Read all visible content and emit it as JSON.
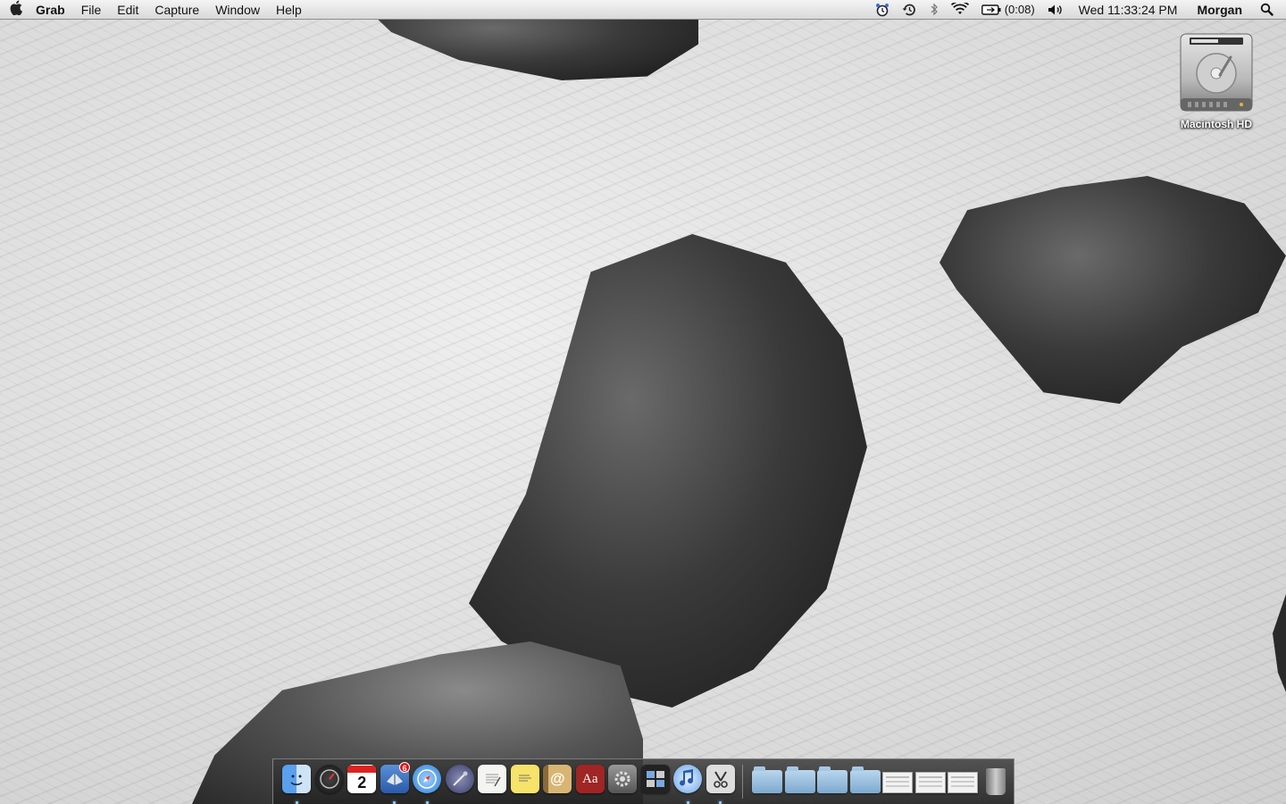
{
  "menubar": {
    "apple_icon": "apple-icon",
    "app_name": "Grab",
    "menus": [
      "File",
      "Edit",
      "Capture",
      "Window",
      "Help"
    ],
    "status": {
      "battery_time": "(0:08)",
      "clock": "Wed 11:33:24 PM",
      "user": "Morgan"
    }
  },
  "desktop": {
    "hd_label": "Macintosh HD"
  },
  "dock": {
    "mail_badge": "6",
    "ical_day": "2",
    "dictionary_text": "Aa",
    "address_book_text": "@",
    "apps": [
      {
        "name": "Finder",
        "icon": "finder-icon",
        "running": true
      },
      {
        "name": "Dashboard",
        "icon": "dashboard-icon",
        "running": false
      },
      {
        "name": "iCal",
        "icon": "ical-icon",
        "running": false
      },
      {
        "name": "Mail",
        "icon": "mail-icon",
        "running": true
      },
      {
        "name": "Safari",
        "icon": "safari-icon",
        "running": true
      },
      {
        "name": "Xcode Instruments",
        "icon": "instruments-icon",
        "running": false
      },
      {
        "name": "TextEdit",
        "icon": "textedit-icon",
        "running": false
      },
      {
        "name": "Stickies",
        "icon": "stickies-icon",
        "running": false
      },
      {
        "name": "Address Book",
        "icon": "address-book-icon",
        "running": false
      },
      {
        "name": "Dictionary",
        "icon": "dictionary-icon",
        "running": false
      },
      {
        "name": "System Preferences",
        "icon": "system-preferences-icon",
        "running": false
      },
      {
        "name": "Spaces",
        "icon": "spaces-icon",
        "running": false
      },
      {
        "name": "iTunes",
        "icon": "itunes-icon",
        "running": true
      },
      {
        "name": "Grab",
        "icon": "grab-icon",
        "running": true
      }
    ]
  }
}
